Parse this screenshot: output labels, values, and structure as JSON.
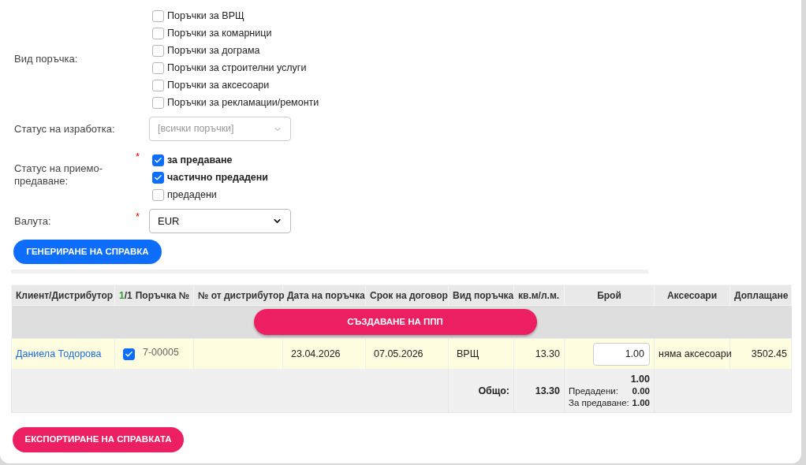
{
  "order_type": {
    "label": "Вид поръчка:",
    "options": [
      {
        "label": "Поръчки за ВРЩ",
        "checked": false
      },
      {
        "label": "Поръчки за комарници",
        "checked": false
      },
      {
        "label": "Поръчки за дограма",
        "checked": false
      },
      {
        "label": "Поръчки за строителни услуги",
        "checked": false
      },
      {
        "label": "Поръчки за аксесоари",
        "checked": false
      },
      {
        "label": "Поръчки за рекламации/ремонти",
        "checked": false
      }
    ]
  },
  "production_status": {
    "label": "Статус на изработка:",
    "value": "[всички поръчки]"
  },
  "handover_status": {
    "label": "Статус на приемо-предаване:",
    "required_mark": "*",
    "options": [
      {
        "label": "за предаване",
        "checked": true
      },
      {
        "label": "частично предадени",
        "checked": true
      },
      {
        "label": "предадени",
        "checked": false
      }
    ]
  },
  "currency": {
    "label": "Валута:",
    "required_mark": "*",
    "value": "EUR"
  },
  "generate_button": "ГЕНЕРИРАНЕ НА СПРАВКА",
  "table": {
    "columns": [
      "Клиент/Дистрибутор",
      "Поръчка №",
      "№ от дистрибутор",
      "Дата на поръчка",
      "Срок на договор",
      "Вид поръчка",
      "кв.м/л.м.",
      "Брой",
      "Аксесоари",
      "Доплащане"
    ],
    "selected_count": "1",
    "total_count": "/1",
    "create_button": "СЪЗДАВАНЕ НА ППП",
    "rows": [
      {
        "client": "Даниела Тодорова",
        "checked": true,
        "order_no": "7-00005",
        "order_date": "23.04.2026",
        "deadline": "07.05.2026",
        "type": "ВРЩ",
        "area": "13.30",
        "quantity": "1.00",
        "accessories": "няма аксесоари",
        "surcharge": "3502.45"
      }
    ],
    "totals": {
      "label": "Общо:",
      "area": "13.30",
      "quantity": "1.00",
      "handed_label": "Предадени:",
      "handed": "0.00",
      "to_hand_label": "За предаване:",
      "to_hand": "1.00"
    }
  },
  "export_button": "ЕКСПОРТИРАНЕ НА СПРАВКАТА"
}
